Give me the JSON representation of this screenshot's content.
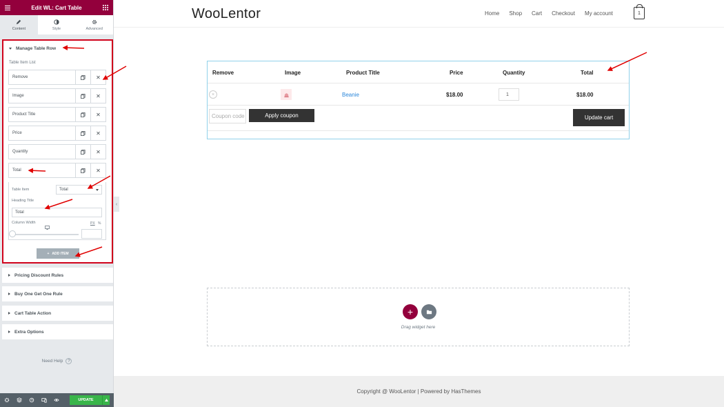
{
  "editor": {
    "title": "Edit WL: Cart Table",
    "tabs": [
      {
        "label": "Content"
      },
      {
        "label": "Style"
      },
      {
        "label": "Advanced"
      }
    ],
    "section_title": "Manage Table Row",
    "list_label": "Table Item List",
    "rows": [
      "Remove",
      "Image",
      "Product Title",
      "Price",
      "Quantity",
      "Total"
    ],
    "item_editor": {
      "table_item_label": "Table Item",
      "table_item_value": "Total",
      "heading_title_label": "Heading Title",
      "heading_title_value": "Total",
      "column_width_label": "Column Width",
      "unit_px": "PX",
      "unit_pct": "%",
      "column_width_value": 0
    },
    "add_item_label": "ADD ITEM",
    "collapsed_sections": [
      "Pricing Discount Rules",
      "Buy One Get One Rule",
      "Cart Table Action",
      "Extra Options"
    ],
    "need_help": "Need Help",
    "need_help_icon": "?",
    "update_label": "UPDATE",
    "accent_color": "#93003c",
    "update_color": "#39b54a"
  },
  "site": {
    "logo": "WooLentor",
    "nav": [
      "Home",
      "Shop",
      "Cart",
      "Checkout",
      "My account"
    ],
    "cart_count": "1",
    "footer": "Copyright @ WooLentor | Powered by HasThemes"
  },
  "cart": {
    "headers": [
      "Remove",
      "Image",
      "Product Title",
      "Price",
      "Quantity",
      "Total"
    ],
    "item": {
      "remove": "×",
      "name": "Beanie",
      "price": "$18.00",
      "quantity": "1",
      "total": "$18.00"
    },
    "coupon_placeholder": "Coupon code",
    "apply_label": "Apply coupon",
    "update_label": "Update cart"
  },
  "dropzone": {
    "add_icon": "+",
    "text": "Drag widget here"
  }
}
